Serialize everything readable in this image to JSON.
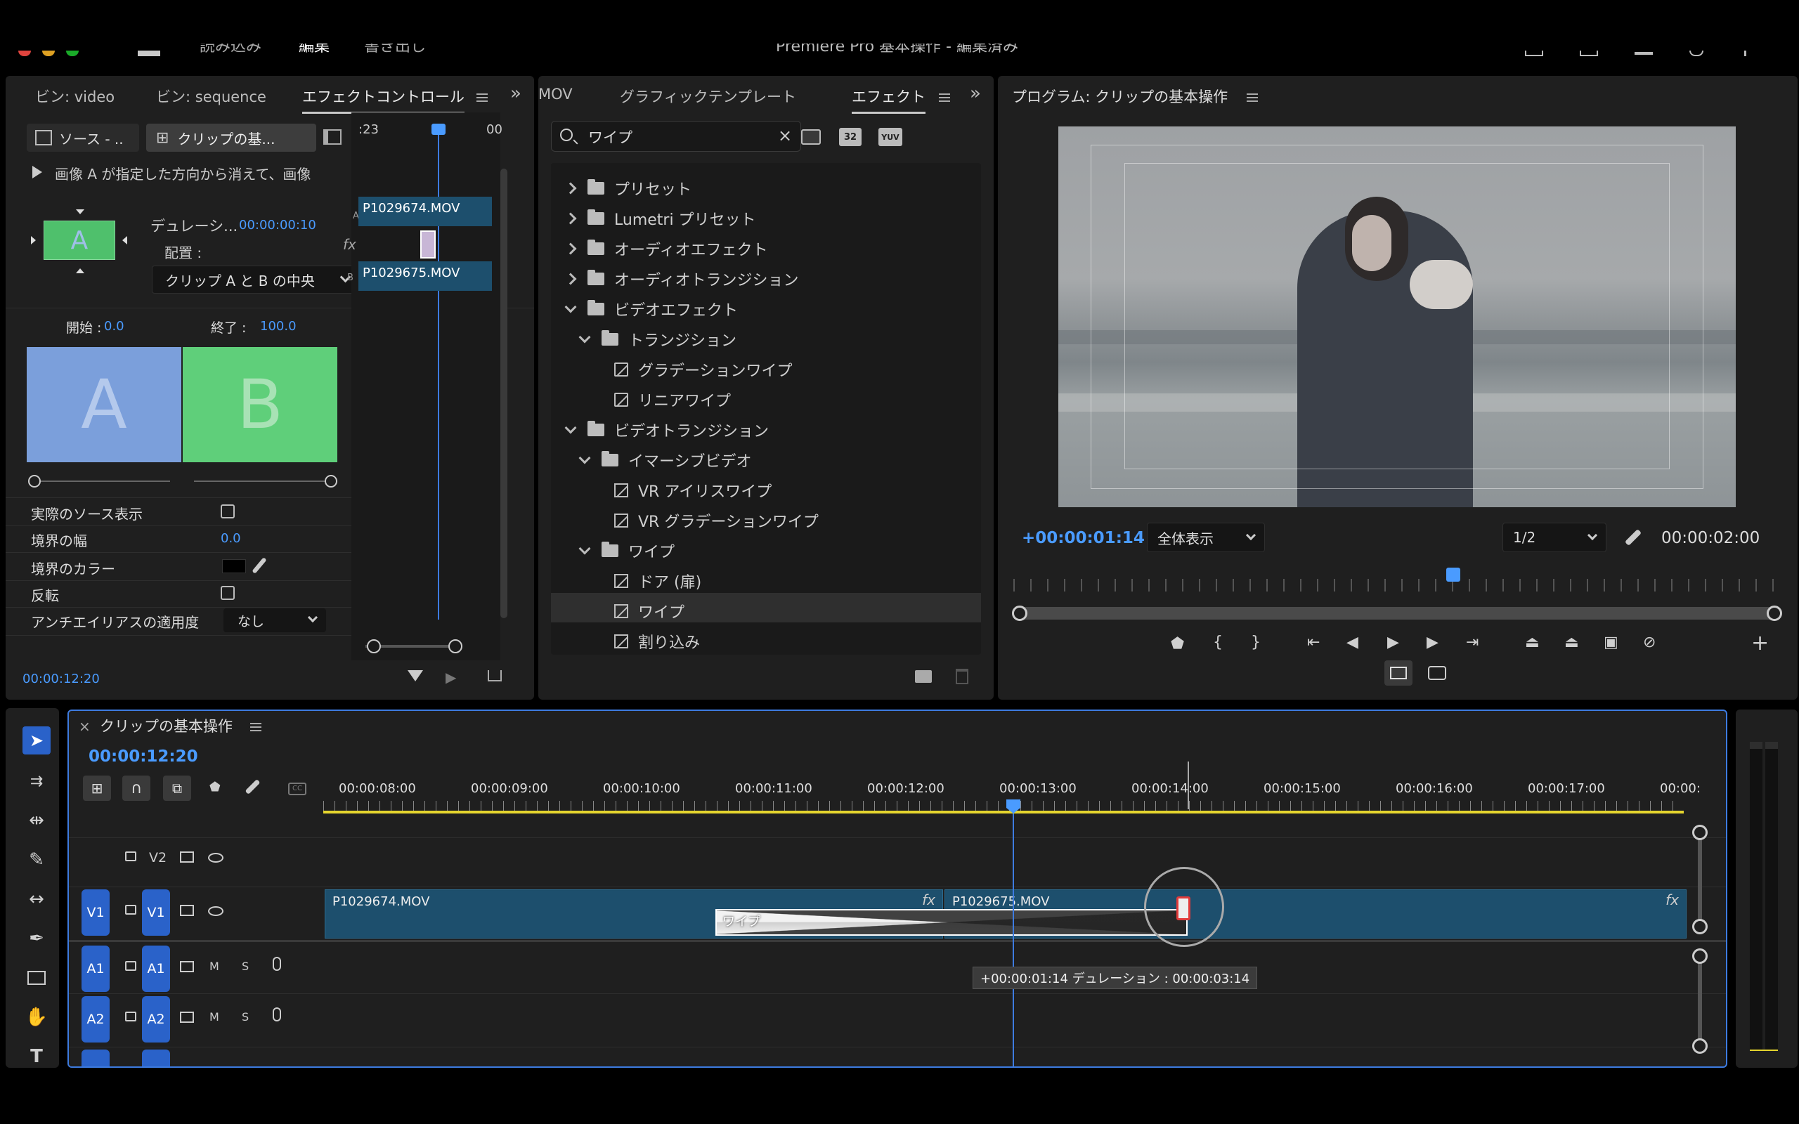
{
  "menubar": {
    "items": [
      "読み込み",
      "編集",
      "書き出し"
    ],
    "title": "Premiere Pro 基本操作 - 編集済み"
  },
  "source_panel": {
    "tabs": [
      "ビン: video",
      "ビン: sequence",
      "エフェクトコントロール"
    ],
    "source_btn": "ソース - ..",
    "clip_btn": "クリップの基...",
    "description": "画像 A が指定した方向から消えて、画像",
    "duration_label": "デュレーシ...",
    "duration_value": "00:00:00:10",
    "alignment_label": "配置 :",
    "alignment_value": "クリップ A と B の中央",
    "start_label": "開始 :",
    "start_value": "0.0",
    "end_label": "終了 :",
    "end_value": "100.0",
    "preview_a": "A",
    "preview_b": "B",
    "thumb_letter": "A",
    "props": [
      {
        "label": "実際のソース表示"
      },
      {
        "label": "境界の幅",
        "value": "0.0"
      },
      {
        "label": "境界のカラー"
      },
      {
        "label": "反転"
      },
      {
        "label": "アンチエイリアスの適用度",
        "value": "なし"
      }
    ],
    "mini_time": ":23",
    "mini_time2": "00",
    "clip_a": "P1029674.MOV",
    "clip_b": "P1029675.MOV",
    "fx": "fx",
    "track_a": "A",
    "track_b": "B",
    "timecode": "00:00:12:20"
  },
  "effects_panel": {
    "tabs": [
      "MOV",
      "グラフィックテンプレート",
      "エフェクト"
    ],
    "search_value": "ワイプ",
    "badges": [
      "32",
      "YUV"
    ],
    "tree": [
      {
        "label": "プリセット",
        "type": "folder",
        "open": false,
        "level": 0
      },
      {
        "label": "Lumetri プリセット",
        "type": "folder",
        "open": false,
        "level": 0
      },
      {
        "label": "オーディオエフェクト",
        "type": "folder",
        "open": false,
        "level": 0
      },
      {
        "label": "オーディオトランジション",
        "type": "folder",
        "open": false,
        "level": 0
      },
      {
        "label": "ビデオエフェクト",
        "type": "folder",
        "open": true,
        "level": 0
      },
      {
        "label": "トランジション",
        "type": "folder",
        "open": true,
        "level": 1
      },
      {
        "label": "グラデーションワイプ",
        "type": "effect",
        "level": 2
      },
      {
        "label": "リニアワイプ",
        "type": "effect",
        "level": 2
      },
      {
        "label": "ビデオトランジション",
        "type": "folder",
        "open": true,
        "level": 0
      },
      {
        "label": "イマーシブビデオ",
        "type": "folder",
        "open": true,
        "level": 1
      },
      {
        "label": "VR アイリスワイプ",
        "type": "transition",
        "level": 2
      },
      {
        "label": "VR グラデーションワイプ",
        "type": "transition",
        "level": 2
      },
      {
        "label": "ワイプ",
        "type": "folder",
        "open": true,
        "level": 1
      },
      {
        "label": "ドア (扉)",
        "type": "transition",
        "level": 2
      },
      {
        "label": "ワイプ",
        "type": "transition",
        "level": 2,
        "selected": true
      },
      {
        "label": "割り込み",
        "type": "transition",
        "level": 2
      }
    ]
  },
  "program_panel": {
    "title": "プログラム: クリップの基本操作",
    "timecode": "+00:00:01:14",
    "zoom": "全体表示",
    "resolution": "1/2",
    "duration": "00:00:02:00",
    "playhead_position": 0.5
  },
  "timeline": {
    "tab": "クリップの基本操作",
    "timecode": "00:00:12:20",
    "ruler": [
      "00:00:08:00",
      "00:00:09:00",
      "00:00:10:00",
      "00:00:11:00",
      "00:00:12:00",
      "00:00:13:00",
      "00:00:14:00",
      "00:00:15:00",
      "00:00:16:00",
      "00:00:17:00",
      "00:00:"
    ],
    "tracks": {
      "v2": "V2",
      "v1a": "V1",
      "v1b": "V1",
      "a1a": "A1",
      "a1b": "A1",
      "a2a": "A2",
      "a2b": "A2",
      "m": "M",
      "s": "S"
    },
    "clip1": "P1029674.MOV",
    "clip2": "P1029675.MOV",
    "fx": "fx",
    "transition": "ワイプ",
    "tooltip": "+00:00:01:14 デュレーション : 00:00:03:14"
  },
  "colors": {
    "accent": "#4a9bff",
    "clip": "#1d4f6d",
    "track_btn": "#2a62c9",
    "preview_a": "#7b9fdb",
    "preview_b": "#5fcf7a"
  }
}
